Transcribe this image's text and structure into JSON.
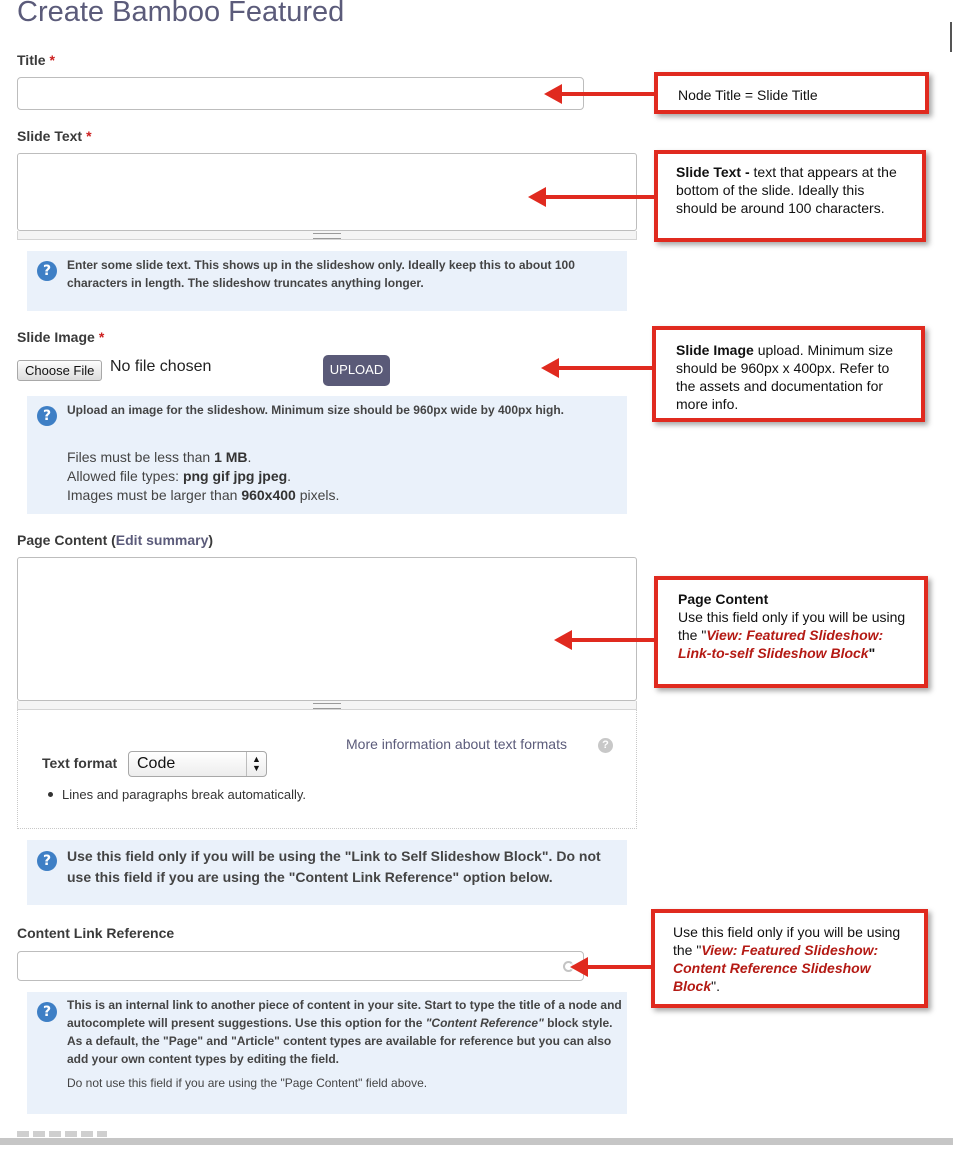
{
  "page": {
    "title": "Create Bamboo Featured"
  },
  "fields": {
    "title": {
      "label": "Title",
      "required": "*",
      "value": ""
    },
    "slide_text": {
      "label": "Slide Text",
      "required": "*",
      "value": "",
      "help": "Enter some slide text. This shows up in the slideshow only. Ideally keep this to about 100 characters in length. The slideshow truncates anything longer."
    },
    "slide_image": {
      "label": "Slide Image",
      "required": "*",
      "choose_file": "Choose File",
      "no_file": "No file chosen",
      "upload": "UPLOAD",
      "help": "Upload an image for the slideshow. Minimum size should be 960px wide by 400px high.",
      "size_prefix": "Files must be less than ",
      "size_value": "1 MB",
      "size_suffix": ".",
      "types_prefix": "Allowed file types: ",
      "types_value": "png gif jpg jpeg",
      "types_suffix": ".",
      "dims_prefix": "Images must be larger than ",
      "dims_value": "960x400",
      "dims_suffix": " pixels."
    },
    "page_content": {
      "label": "Page Content",
      "paren_open": "(",
      "edit_summary": "Edit summary",
      "paren_close": ")",
      "more_info": "More information about text formats",
      "text_format_label": "Text format",
      "text_format_value": "Code",
      "tip": "Lines and paragraphs break automatically.",
      "help": "Use this field only if you will be using the \"Link to Self Slideshow Block\". Do not use this field if you are using the \"Content Link Reference\" option below."
    },
    "content_link": {
      "label": "Content Link Reference",
      "value": "",
      "help_a": "This is an internal link to another piece of content in your site. Start to type the title of a node and autocomplete will present suggestions. Use this option for the ",
      "help_em": "\"Content Reference\"",
      "help_b": " block style. As a default, the \"Page\" and \"Article\" content types are available for reference but you can also add your own content types by editing the field.",
      "help_note": "Do not use this field if you are using the \"Page Content\" field above."
    }
  },
  "callouts": {
    "title": {
      "text": "Node Title = Slide Title"
    },
    "slide_text": {
      "bold": "Slide Text -",
      "text": " text that appears at the bottom of the slide. Ideally this should be around 100 characters."
    },
    "slide_image": {
      "bold": "Slide Image",
      "text": " upload. Minimum size should be 960px x 400px. Refer to the assets and documentation for more info."
    },
    "page_content": {
      "bold": "Page Content",
      "line": "Use this field only if you will be using the \"",
      "em": "View: Featured Slideshow: Link-to-self Slideshow Block",
      "end": "\""
    },
    "content_link": {
      "line": "Use this field only if you will be using the \"",
      "em": "View: Featured Slideshow: Content Reference Slideshow Block",
      "end": "\"."
    }
  },
  "colors": {
    "accent_red": "#e02a1f",
    "help_bg": "#eaf1fa",
    "help_icon": "#3e7fc5",
    "title": "#5b5b7a"
  },
  "icons": {
    "help": "question-circle-icon",
    "format_help": "question-circle-icon",
    "autocomplete": "throbber-icon",
    "select": "select-arrows-icon"
  }
}
